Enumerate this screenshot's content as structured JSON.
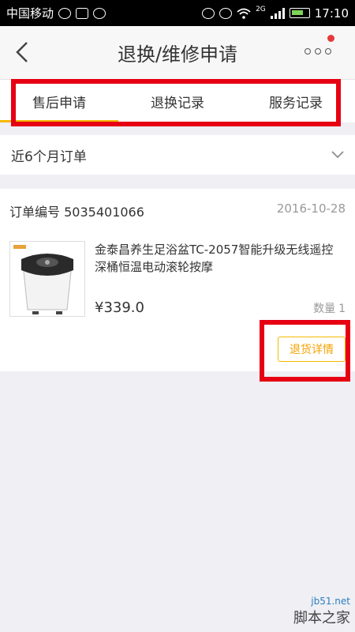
{
  "statusbar": {
    "carrier": "中国移动",
    "network": "2G",
    "time": "17:10",
    "left_icons": [
      "wechat-icon",
      "image-icon",
      "app-icon"
    ],
    "right_icons": [
      "headphones-icon",
      "alarm-icon",
      "wifi-icon",
      "signal-icon",
      "battery-icon"
    ]
  },
  "header": {
    "title": "退换/维修申请",
    "icons": [
      "back-icon",
      "more-icon"
    ]
  },
  "tabs": [
    {
      "label": "售后申请",
      "active": true
    },
    {
      "label": "退换记录",
      "active": false
    },
    {
      "label": "服务记录",
      "active": false
    }
  ],
  "filter": {
    "label": "近6个月订单",
    "icon": "chevron-down-icon"
  },
  "order": {
    "number_label": "订单编号",
    "number": "5035401066",
    "date": "2016-10-28",
    "product_name": "金泰昌养生足浴盆TC-2057智能升级无线遥控深桶恒温电动滚轮按摩",
    "price": "¥339.0",
    "qty_label": "数量",
    "qty_value": "1",
    "detail_button": "退货详情"
  },
  "watermark": {
    "site": "jb51.net",
    "name": "脚本之家"
  },
  "colors": {
    "accent": "#f5b800",
    "highlight_frame": "#e60012"
  }
}
